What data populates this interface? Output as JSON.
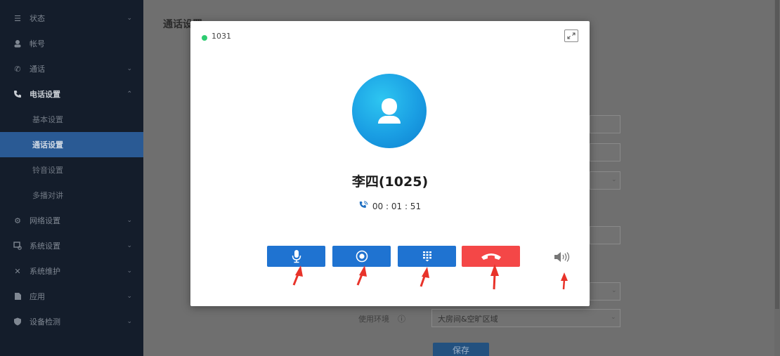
{
  "sidebar": {
    "items": [
      {
        "label": "状态",
        "icon": "list-icon",
        "chevron": "⌄"
      },
      {
        "label": "帐号",
        "icon": "user-icon",
        "chevron": ""
      },
      {
        "label": "通话",
        "icon": "phone-call-icon",
        "chevron": "⌄"
      },
      {
        "label": "电话设置",
        "icon": "phone-icon",
        "chevron": "⌃"
      },
      {
        "label": "网络设置",
        "icon": "network-icon",
        "chevron": "⌄"
      },
      {
        "label": "系统设置",
        "icon": "system-icon",
        "chevron": "⌄"
      },
      {
        "label": "系统维护",
        "icon": "tools-icon",
        "chevron": "⌄"
      },
      {
        "label": "应用",
        "icon": "app-icon",
        "chevron": "⌄"
      },
      {
        "label": "设备检测",
        "icon": "shield-icon",
        "chevron": "⌄"
      }
    ],
    "sub_items": [
      {
        "label": "基本设置"
      },
      {
        "label": "通话设置"
      },
      {
        "label": "铃音设置"
      },
      {
        "label": "多播对讲"
      }
    ]
  },
  "main": {
    "title": "通话设置",
    "env_label": "使用环境",
    "env_value": "大房间&空旷区域",
    "save_label": "保存"
  },
  "modal": {
    "account": "1031",
    "caller": "李四(1025)",
    "duration": "00 : 01 : 51",
    "status_color": "#2ecc71",
    "buttons": {
      "mute": "mic-icon",
      "record": "record-icon",
      "keypad": "keypad-icon",
      "hangup": "hangup-icon",
      "speaker": "speaker-icon"
    },
    "colors": {
      "primary": "#1f73d1",
      "danger": "#f44747",
      "annotation": "#e8332a"
    }
  }
}
